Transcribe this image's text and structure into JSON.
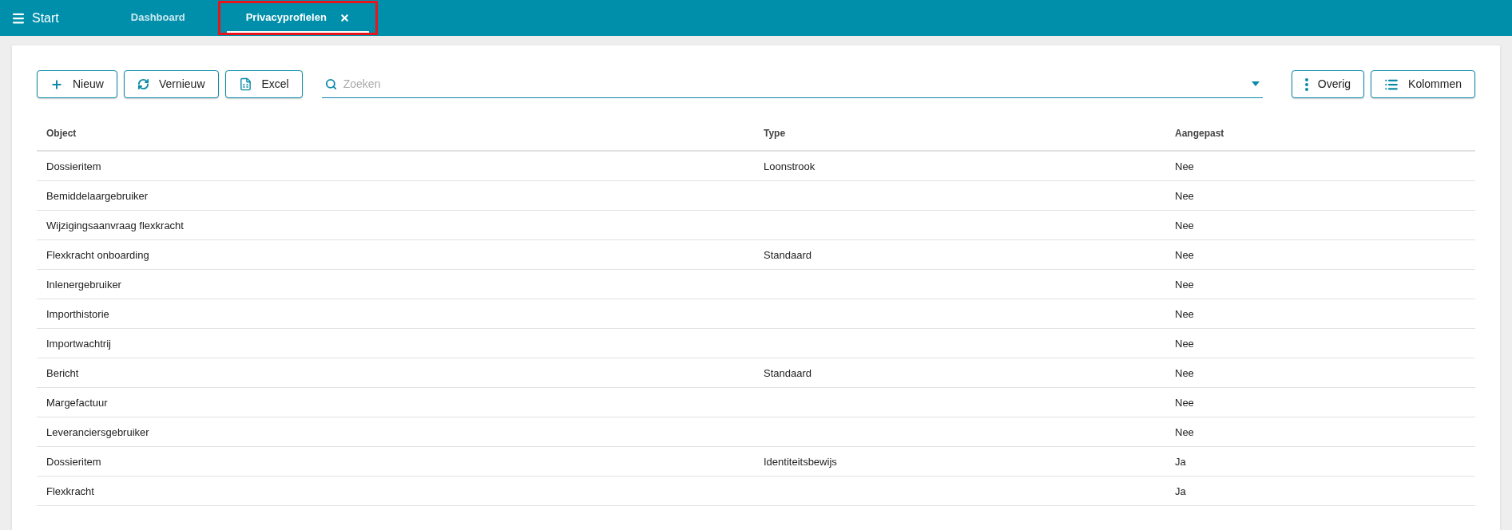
{
  "topbar": {
    "start_label": "Start",
    "tabs": [
      {
        "label": "Dashboard",
        "selected": false,
        "closable": false,
        "highlighted": false
      },
      {
        "label": "Privacyprofielen",
        "selected": true,
        "closable": true,
        "highlighted": true
      }
    ]
  },
  "toolbar": {
    "buttons": [
      {
        "label": "Nieuw",
        "kind": "plus"
      },
      {
        "label": "Vernieuw",
        "kind": "refresh"
      },
      {
        "label": "Excel",
        "kind": "excel"
      }
    ],
    "search": {
      "placeholder": "Zoeken"
    },
    "right_buttons": [
      {
        "label": "Overig",
        "kind": "dots"
      },
      {
        "label": "Kolommen",
        "kind": "list"
      }
    ]
  },
  "table": {
    "columns": [
      "Object",
      "Type",
      "Aangepast"
    ],
    "rows": [
      [
        "Dossieritem",
        "Loonstrook",
        "Nee"
      ],
      [
        "Bemiddelaargebruiker",
        "",
        "Nee"
      ],
      [
        "Wijzigingsaanvraag flexkracht",
        "",
        "Nee"
      ],
      [
        "Flexkracht onboarding",
        "Standaard",
        "Nee"
      ],
      [
        "Inlenergebruiker",
        "",
        "Nee"
      ],
      [
        "Importhistorie",
        "",
        "Nee"
      ],
      [
        "Importwachtrij",
        "",
        "Nee"
      ],
      [
        "Bericht",
        "Standaard",
        "Nee"
      ],
      [
        "Margefactuur",
        "",
        "Nee"
      ],
      [
        "Leveranciersgebruiker",
        "",
        "Nee"
      ],
      [
        "Dossieritem",
        "Identiteitsbewijs",
        "Ja"
      ],
      [
        "Flexkracht",
        "",
        "Ja"
      ]
    ]
  }
}
